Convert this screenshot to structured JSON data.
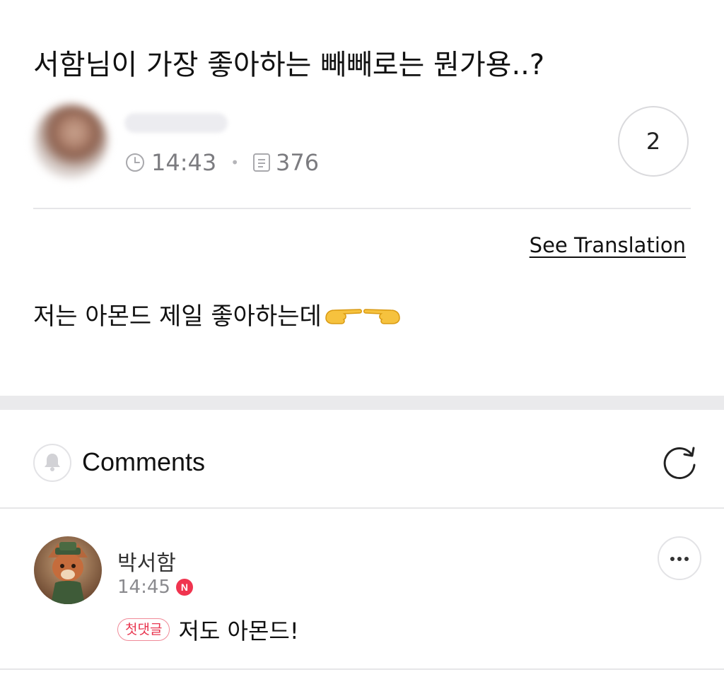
{
  "post": {
    "title": "서함님이 가장 좋아하는 빼빼로는 뭔가용..?",
    "author_name": "",
    "time": "14:43",
    "views": "376",
    "comment_count": "2",
    "see_translation": "See Translation",
    "body": "저는 아몬드 제일 좋아하는데"
  },
  "comments_section": {
    "heading": "Comments"
  },
  "comments": [
    {
      "author": "박서함",
      "time": "14:45",
      "new_badge": "N",
      "first_badge": "첫댓글",
      "text": "저도 아몬드!"
    }
  ],
  "icons": {
    "time": "clock-icon",
    "views": "document-icon",
    "notify": "bell-icon",
    "refresh": "refresh-icon",
    "more": "more-icon",
    "emoji": "pointing-hands-emoji"
  },
  "colors": {
    "new_badge": "#f0344f",
    "first_badge": "#e8344e"
  }
}
